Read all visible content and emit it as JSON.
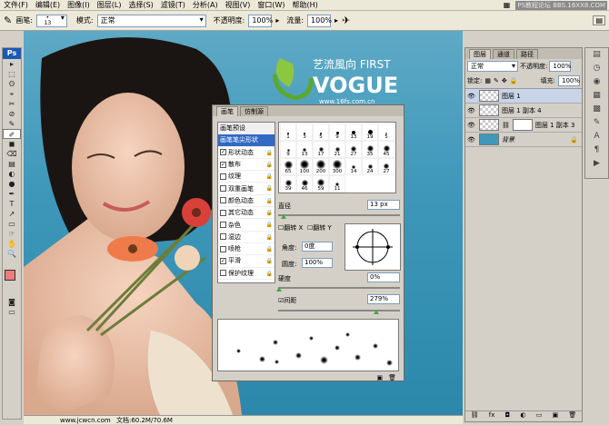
{
  "menu": {
    "items": [
      "文件(F)",
      "编辑(E)",
      "图像(I)",
      "图层(L)",
      "选择(S)",
      "滤镜(T)",
      "分析(A)",
      "视图(V)",
      "窗口(W)",
      "帮助(H)"
    ],
    "watermark": "PS教程论坛 BBS.16XX8.COM"
  },
  "options": {
    "brush_label": "画笔:",
    "brush_size": "13",
    "mode_label": "模式:",
    "mode_value": "正常",
    "opacity_label": "不透明度:",
    "opacity_value": "100%",
    "flow_label": "流量:",
    "flow_value": "100%"
  },
  "toolbox": {
    "logo": "Ps",
    "tools": [
      "▸",
      "⬚",
      "ʘ",
      "⌖",
      "✂",
      "⊘",
      "✎",
      "✐",
      "◼",
      "⌫",
      "▤",
      "◐",
      "●",
      "✒",
      "T",
      "↗",
      "▭",
      "☞",
      "✋",
      "🔍"
    ]
  },
  "canvas": {
    "logo_text": "艺流風向 FIRST",
    "logo_big": "VOGUE",
    "logo_url": "www.16fs.com.cn"
  },
  "statusbar": {
    "text": "文档:60.2M/70.6M",
    "site": "www.jcwcn.com"
  },
  "brush_panel": {
    "tabs": [
      "画笔",
      "仿制源"
    ],
    "presets_label": "画笔预设",
    "items": [
      {
        "label": "画笔笔尖形状",
        "checked": null,
        "locked": false
      },
      {
        "label": "形状动态",
        "checked": true,
        "locked": true
      },
      {
        "label": "散布",
        "checked": true,
        "locked": true
      },
      {
        "label": "纹理",
        "checked": false,
        "locked": true
      },
      {
        "label": "双重画笔",
        "checked": false,
        "locked": true
      },
      {
        "label": "颜色动态",
        "checked": false,
        "locked": true
      },
      {
        "label": "其它动态",
        "checked": false,
        "locked": true
      },
      {
        "label": "杂色",
        "checked": false,
        "locked": true
      },
      {
        "label": "湿边",
        "checked": false,
        "locked": true
      },
      {
        "label": "喷枪",
        "checked": false,
        "locked": true
      },
      {
        "label": "平滑",
        "checked": true,
        "locked": true
      },
      {
        "label": "保护纹理",
        "checked": false,
        "locked": true
      }
    ],
    "tips": [
      "1",
      "3",
      "5",
      "9",
      "13",
      "19",
      "5",
      "9",
      "13",
      "17",
      "21",
      "27",
      "35",
      "45",
      "65",
      "100",
      "200",
      "300",
      "14",
      "24",
      "27",
      "39",
      "46",
      "59",
      "11"
    ],
    "diameter_label": "直径",
    "diameter_value": "13 px",
    "flip_x": "翻转 X",
    "flip_y": "翻转 Y",
    "angle_label": "角度:",
    "angle_value": "0度",
    "roundness_label": "圆度:",
    "roundness_value": "100%",
    "hardness_label": "硬度",
    "hardness_value": "0%",
    "spacing_label": "间距",
    "spacing_value": "279%"
  },
  "layers_panel": {
    "tabs": [
      "图层",
      "通道",
      "路径"
    ],
    "blend_mode": "正常",
    "opacity_label": "不透明度:",
    "opacity_value": "100%",
    "lock_label": "锁定:",
    "fill_label": "填充:",
    "fill_value": "100%",
    "layers": [
      {
        "name": "图层 1",
        "selected": true
      },
      {
        "name": "图层 1 副本 4",
        "selected": false
      },
      {
        "name": "图层 1 副本 3",
        "selected": false
      },
      {
        "name": "背景",
        "selected": false
      }
    ]
  },
  "colors": {
    "accent": "#1b59b4",
    "panel": "#d4d0c8",
    "sky": "#3f98ba",
    "foreground": "#ef7b7b"
  }
}
